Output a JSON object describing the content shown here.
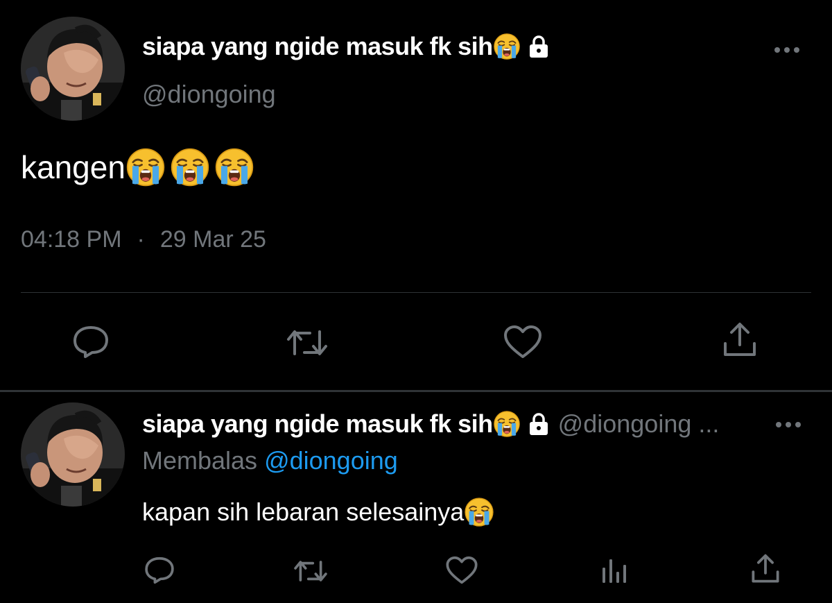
{
  "main_tweet": {
    "display_name": "siapa yang ngide masuk fk sih",
    "handle": "@diongoing",
    "text": "kangen",
    "time": "04:18 PM",
    "separator": "·",
    "date": "29 Mar 25",
    "name_emoji": "loudly-crying-face-emoji",
    "protected_icon": "lock-icon",
    "text_emojis": [
      "loudly-crying-face-emoji",
      "loudly-crying-face-emoji",
      "loudly-crying-face-emoji"
    ],
    "actions": [
      "reply-icon",
      "retweet-icon",
      "like-icon",
      "share-icon"
    ]
  },
  "reply_tweet": {
    "display_name": "siapa yang ngide masuk fk sih",
    "handle": "@diongoing ...",
    "replying_label": "Membalas",
    "replying_to": "@diongoing",
    "text": "kapan sih lebaran selesainya",
    "name_emoji": "loudly-crying-face-emoji",
    "protected_icon": "lock-icon",
    "text_emoji": "loudly-crying-face-emoji",
    "actions": [
      "reply-icon",
      "retweet-icon",
      "like-icon",
      "views-icon",
      "share-icon"
    ]
  },
  "colors": {
    "background": "#000000",
    "primary_text": "#ffffff",
    "secondary_text": "#71767b",
    "link": "#1d9bf0",
    "divider": "#2f3336"
  }
}
